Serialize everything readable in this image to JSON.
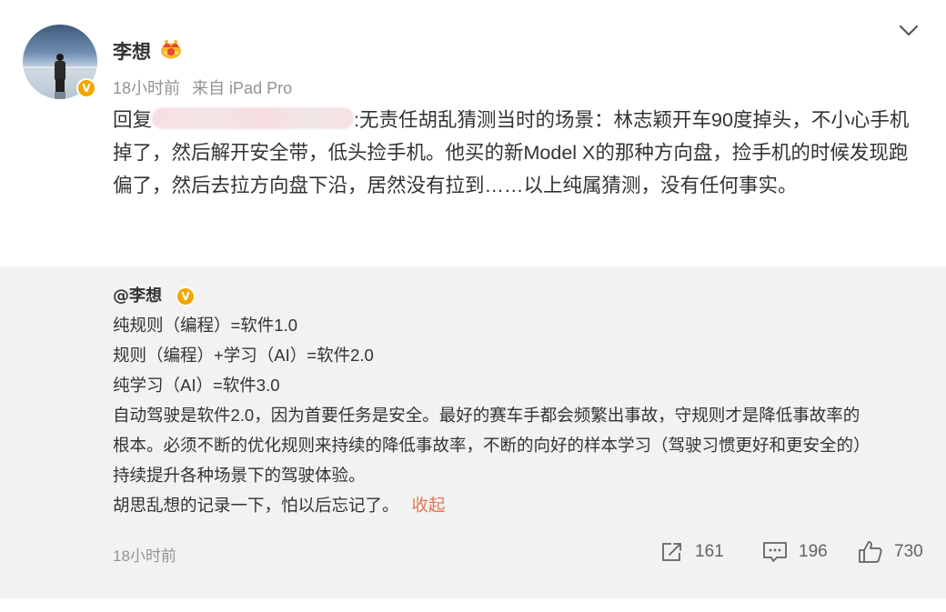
{
  "post": {
    "author": "李想",
    "meta": {
      "time": "18小时前",
      "source": "来自 iPad Pro"
    },
    "reply": {
      "prefix": "回复",
      "text": ":无责任胡乱猜测当时的场景：林志颖开车90度掉头，不小心手机掉了，然后解开安全带，低头捡手机。他买的新Model X的那种方向盘，捡手机的时候发现跑偏了，然后去拉方向盘下沿，居然没有拉到……以上纯属猜测，没有任何事实。"
    }
  },
  "retweet": {
    "author": "@李想",
    "lines": [
      "纯规则（编程）=软件1.0",
      "规则（编程）+学习（AI）=软件2.0",
      "纯学习（AI）=软件3.0",
      "自动驾驶是软件2.0，因为首要任务是安全。最好的赛车手都会频繁出事故，守规则才是降低事故率的",
      "根本。必须不断的优化规则来持续的降低事故率，不断的向好的样本学习（驾驶习惯更好和更安全的）",
      "持续提升各种场景下的驾驶体验。",
      "胡思乱想的记录一下，怕以后忘记了。"
    ],
    "collapse_label": "收起",
    "time": "18小时前",
    "stats": {
      "reposts": "161",
      "comments": "196",
      "likes": "730"
    }
  },
  "icons": {
    "verified": "verified-badge-icon",
    "crown": "crown-icon",
    "chevron": "chevron-down-icon",
    "repost": "repost-icon",
    "comment": "comment-icon",
    "like": "thumbs-up-icon"
  },
  "colors": {
    "verified": "#f3a600",
    "link": "#eb7350",
    "muted": "#939393",
    "retweet_bg": "#f2f2f2"
  }
}
